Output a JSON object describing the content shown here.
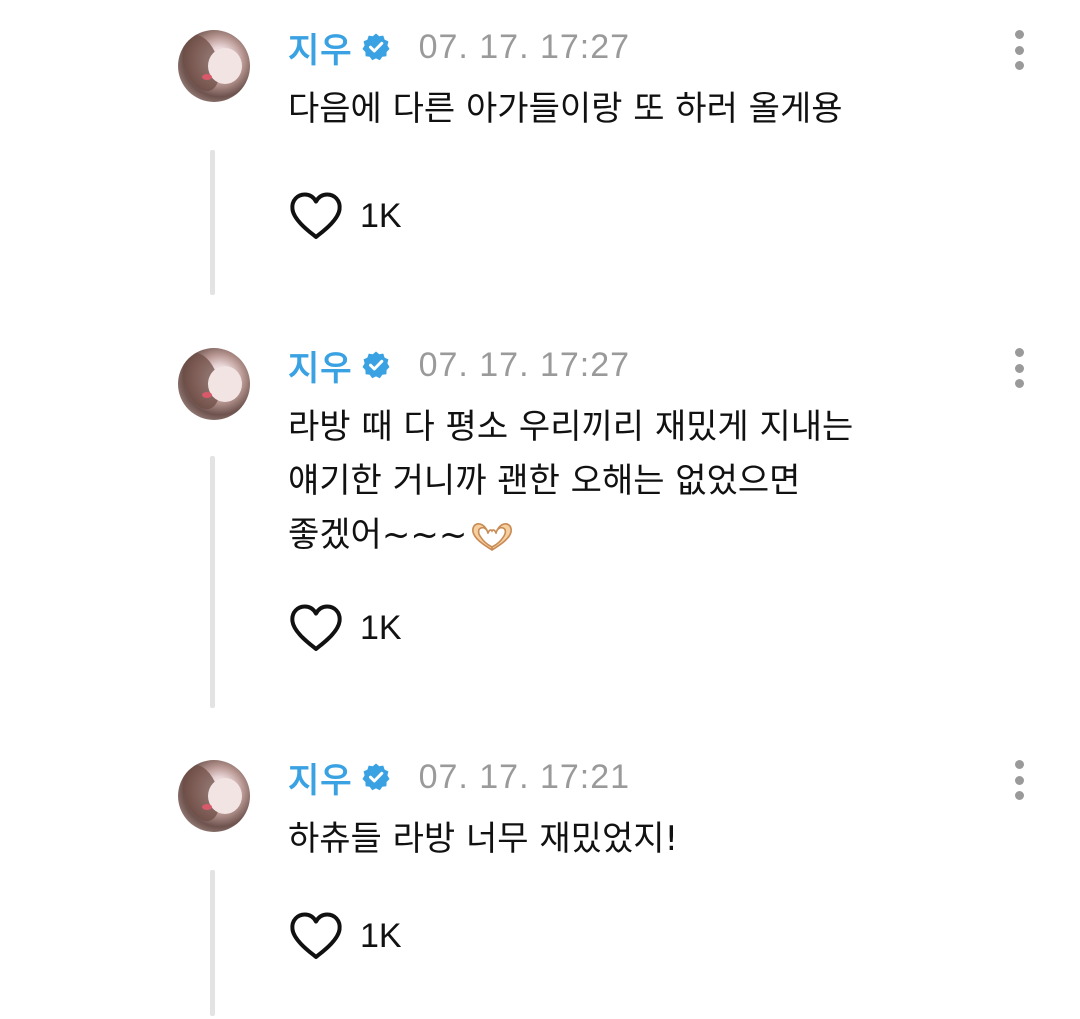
{
  "comments": [
    {
      "author": "지우",
      "verified_icon": "verified-badge-icon",
      "timestamp": "07. 17. 17:27",
      "text": "다음에 다른 아가들이랑 또 하러 올게용",
      "like_icon": "heart-outline-icon",
      "likes": "1K",
      "more_icon": "kebab-menu-icon"
    },
    {
      "author": "지우",
      "verified_icon": "verified-badge-icon",
      "timestamp": "07. 17. 17:27",
      "text": "라방 때 다 평소 우리끼리 재밌게 지내는\n얘기한 거니까 괜한 오해는 없었으면\n좋겠어~~~",
      "text_emoji": "heart-hands-emoji",
      "like_icon": "heart-outline-icon",
      "likes": "1K",
      "more_icon": "kebab-menu-icon"
    },
    {
      "author": "지우",
      "verified_icon": "verified-badge-icon",
      "timestamp": "07. 17. 17:21",
      "text": "하츄들 라방 너무 재밌었지!",
      "like_icon": "heart-outline-icon",
      "likes": "1K",
      "more_icon": "kebab-menu-icon"
    }
  ],
  "colors": {
    "author": "#3aa2e2",
    "verified_badge": "#3aa2e2",
    "timestamp": "#9a9a9a",
    "thread_line": "#e3e3e3",
    "text": "#111111"
  }
}
